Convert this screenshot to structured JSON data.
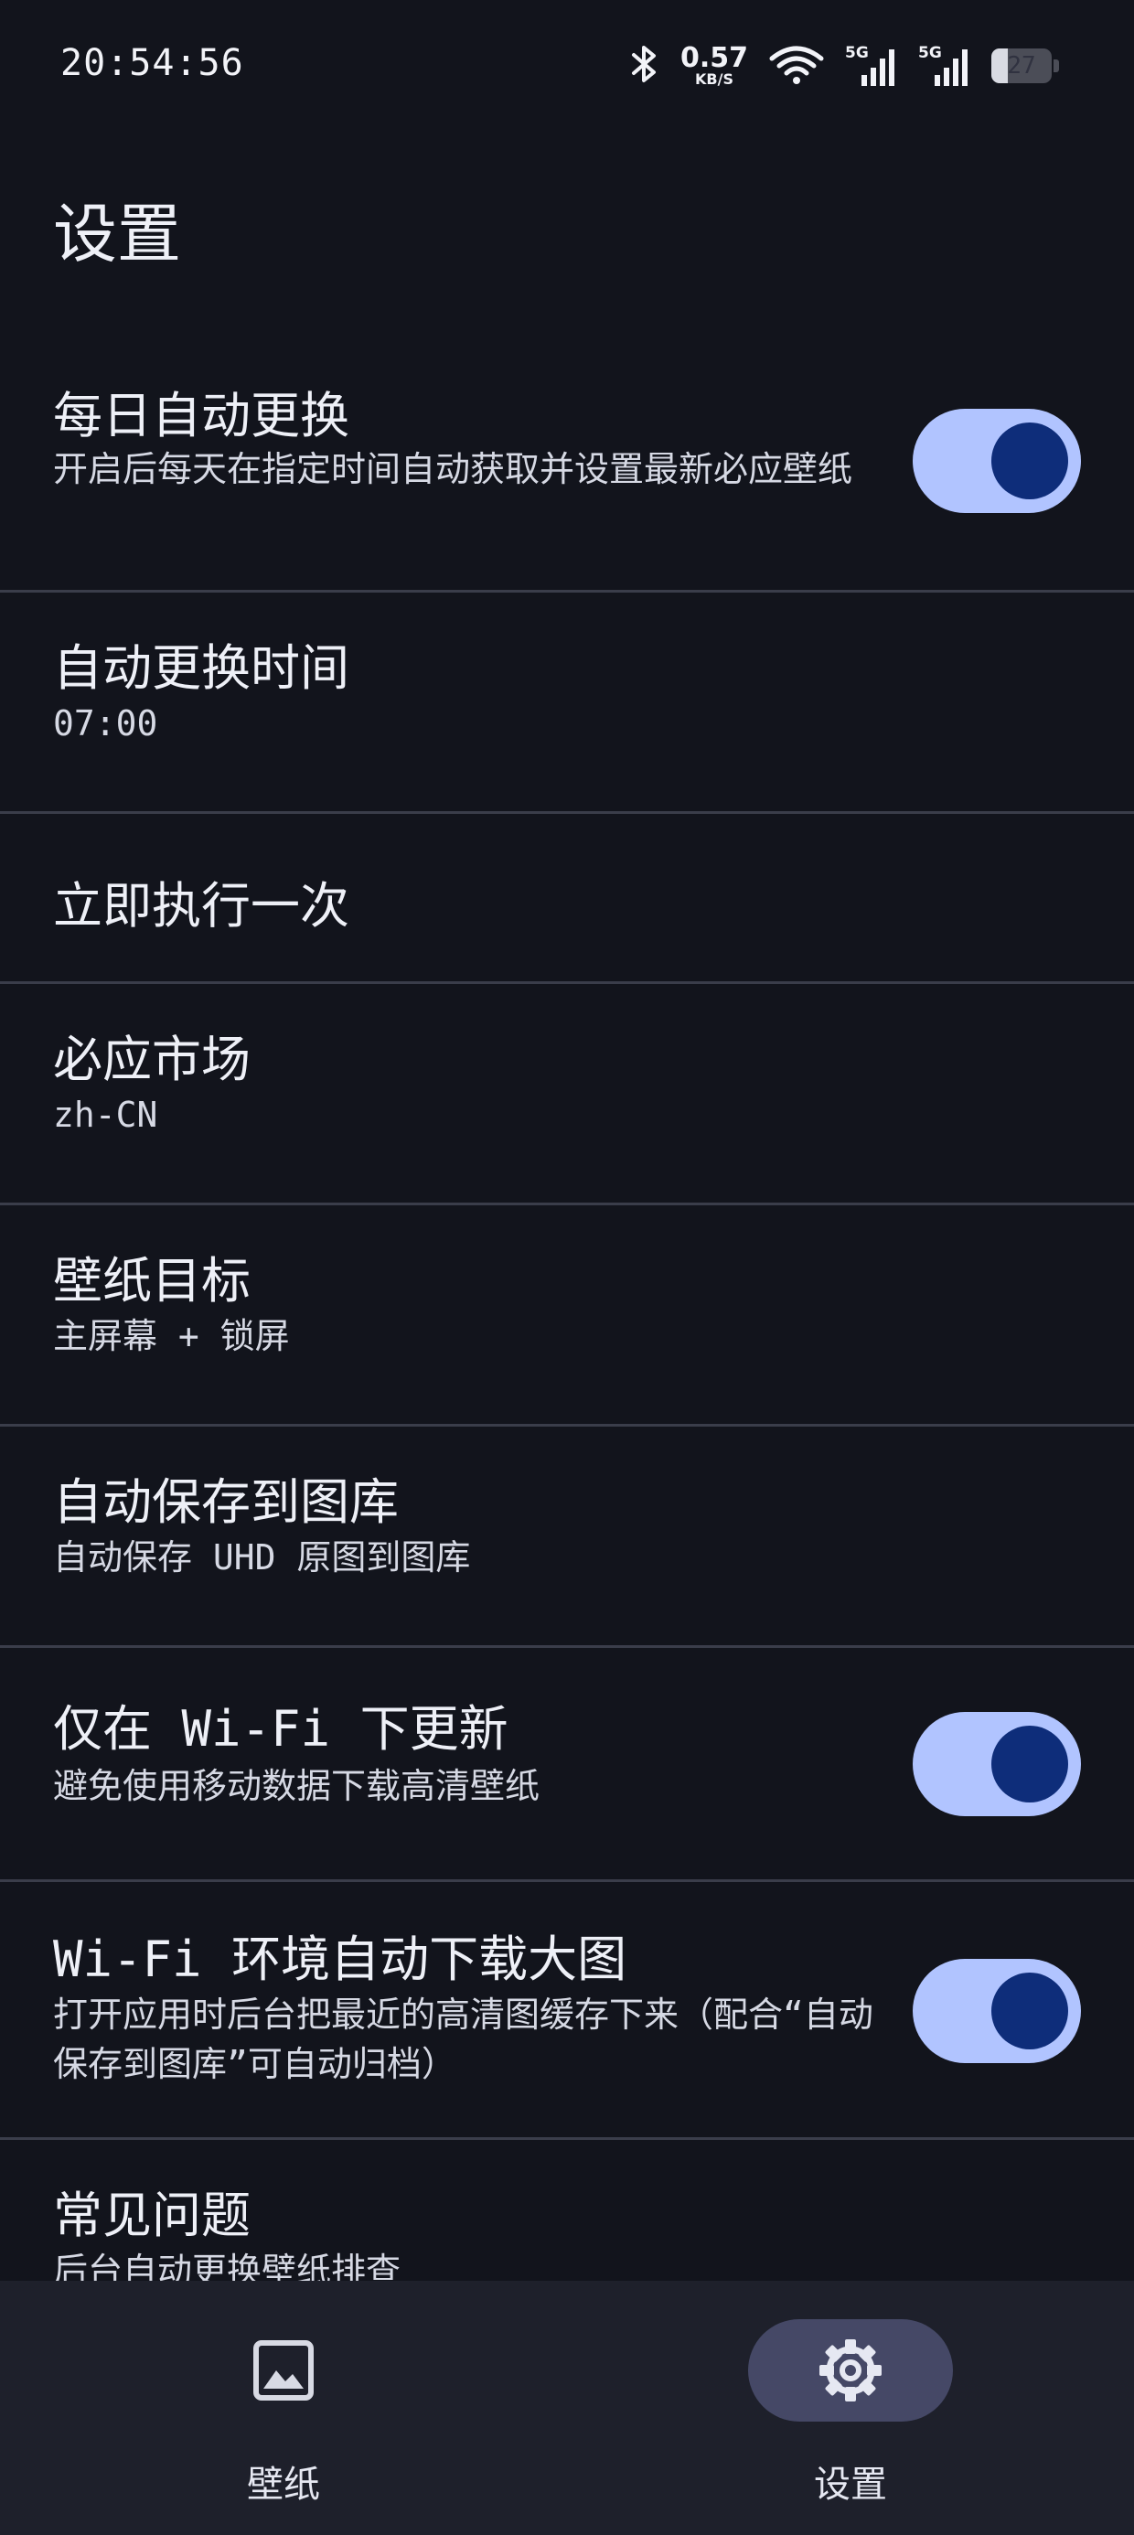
{
  "status_bar": {
    "time": "20:54:56",
    "net_speed_value": "0.57",
    "net_speed_unit": "KB/S",
    "signal_1_label": "5G",
    "signal_2_label": "5G",
    "battery_level": "27"
  },
  "page": {
    "title": "设置"
  },
  "settings": {
    "items": [
      {
        "title": "每日自动更换",
        "subtitle": "开启后每天在指定时间自动获取并设置最新必应壁纸",
        "toggle_on": true
      },
      {
        "title": "自动更换时间",
        "subtitle": "07:00"
      },
      {
        "title": "立即执行一次"
      },
      {
        "title": "必应市场",
        "subtitle": "zh-CN"
      },
      {
        "title": "壁纸目标",
        "subtitle": "主屏幕 + 锁屏"
      },
      {
        "title": "自动保存到图库",
        "subtitle": "自动保存 UHD 原图到图库"
      },
      {
        "title": "仅在 Wi-Fi 下更新",
        "subtitle": "避免使用移动数据下载高清壁纸",
        "toggle_on": true
      },
      {
        "title": "Wi-Fi 环境自动下载大图",
        "subtitle": "打开应用时后台把最近的高清图缓存下来（配合“自动保存到图库”可自动归档）",
        "toggle_on": true
      },
      {
        "title": "常见问题",
        "subtitle": "后台自动更换壁纸排查"
      }
    ]
  },
  "bottom_nav": {
    "wallpaper_label": "壁纸",
    "settings_label": "设置",
    "active": "settings"
  },
  "colors": {
    "background": "#12141c",
    "toggle_track": "#b1c4ff",
    "toggle_knob": "#0e2d7a",
    "nav_background": "#1e202b",
    "nav_active_pill": "#454866"
  }
}
